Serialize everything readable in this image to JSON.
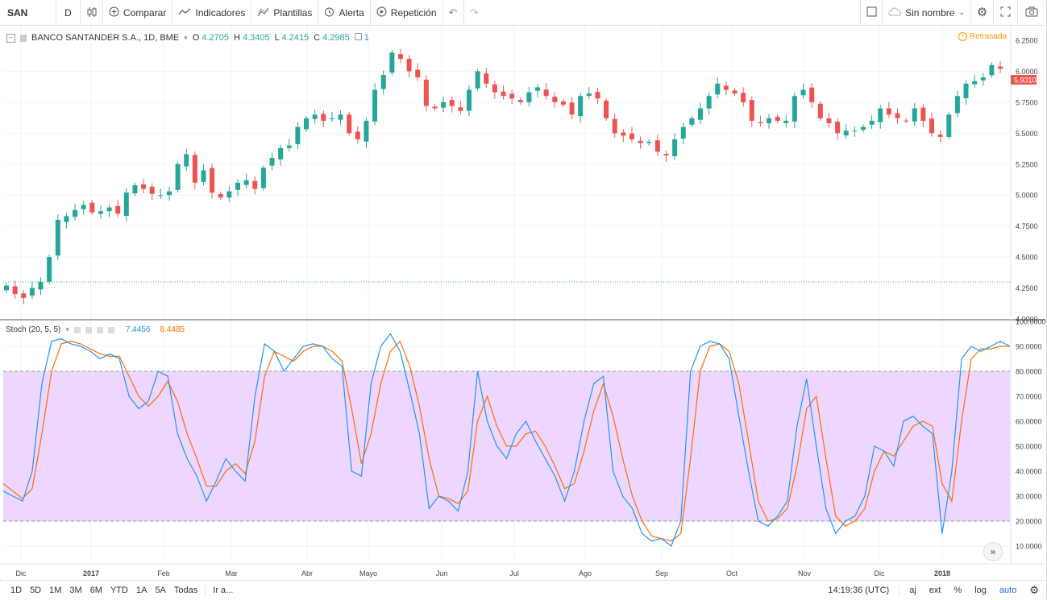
{
  "toolbar": {
    "symbol": "SAN",
    "interval": "D",
    "compare": "Comparar",
    "indicators": "Indicadores",
    "templates": "Plantillas",
    "alert": "Alerta",
    "replay": "Repetición",
    "layout_name": "Sin nombre"
  },
  "legend": {
    "title": "BANCO SANTANDER S.A., 1D, BME",
    "o_label": "O",
    "o_value": "4.2705",
    "h_label": "H",
    "h_value": "4.3405",
    "l_label": "L",
    "l_value": "4.2415",
    "c_label": "C",
    "c_value": "4.2985",
    "badge": "1",
    "status": "Retrasada"
  },
  "stoch_legend": {
    "name": "Stoch (20, 5, 5)",
    "k_value": "7.4456",
    "d_value": "8.4485"
  },
  "price_axis": {
    "ticks": [
      "6.2500",
      "6.0000",
      "5.7500",
      "5.5000",
      "5.2500",
      "5.0000",
      "4.7500",
      "4.5000",
      "4.2500",
      "4.0000"
    ],
    "last_price": "5.9310"
  },
  "stoch_axis": {
    "ticks": [
      "100.0000",
      "90.0000",
      "80.0000",
      "70.0000",
      "60.0000",
      "50.0000",
      "40.0000",
      "30.0000",
      "20.0000",
      "10.0000"
    ]
  },
  "time_axis": {
    "labels": [
      "Dic",
      "2017",
      "Feb",
      "Mar",
      "Abr",
      "Mayo",
      "Jun",
      "Jul",
      "Ago",
      "Sep",
      "Oct",
      "Nov",
      "Dic",
      "2018"
    ]
  },
  "bottombar": {
    "ranges": [
      "1D",
      "5D",
      "1M",
      "3M",
      "6M",
      "YTD",
      "1A",
      "5A",
      "Todas"
    ],
    "goto": "Ir a...",
    "clock": "14:19:36 (UTC)",
    "adj": "aj",
    "ext": "ext",
    "percent": "%",
    "log": "log",
    "auto": "auto"
  },
  "colors": {
    "up": "#26a69a",
    "down": "#ef5350",
    "k_line": "#2196f3",
    "d_line": "#ff6d00",
    "band_fill": "#e8ccff",
    "accent": "#2962ff"
  },
  "chart_data": [
    {
      "type": "candlestick",
      "title": "BANCO SANTANDER S.A., 1D, BME",
      "ylim": [
        4.0,
        6.3
      ],
      "x_labels": [
        "Dic",
        "2017",
        "Feb",
        "Mar",
        "Abr",
        "Mayo",
        "Jun",
        "Jul",
        "Ago",
        "Sep",
        "Oct",
        "Nov",
        "Dic",
        "2018"
      ],
      "close_path": [
        4.27,
        4.2,
        4.17,
        4.25,
        4.3,
        4.5,
        4.8,
        4.83,
        4.88,
        4.92,
        4.86,
        4.87,
        4.9,
        4.85,
        5.02,
        5.08,
        5.05,
        5.01,
        5.0,
        5.03,
        5.25,
        5.33,
        5.1,
        5.2,
        5.02,
        4.98,
        5.03,
        5.1,
        5.12,
        5.05,
        5.22,
        5.3,
        5.38,
        5.4,
        5.55,
        5.62,
        5.65,
        5.6,
        5.62,
        5.65,
        5.5,
        5.45,
        5.6,
        5.85,
        5.97,
        6.15,
        6.1,
        6.0,
        5.95,
        5.72,
        5.7,
        5.75,
        5.72,
        5.68,
        5.85,
        6.0,
        5.9,
        5.83,
        5.8,
        5.78,
        5.75,
        5.83,
        5.87,
        5.8,
        5.75,
        5.73,
        5.65,
        5.8,
        5.82,
        5.78,
        5.62,
        5.5,
        5.48,
        5.45,
        5.42,
        5.43,
        5.35,
        5.32,
        5.45,
        5.55,
        5.62,
        5.7,
        5.8,
        5.9,
        5.85,
        5.82,
        5.75,
        5.6,
        5.58,
        5.62,
        5.6,
        5.6,
        5.8,
        5.85,
        5.75,
        5.62,
        5.58,
        5.5,
        5.52,
        5.52,
        5.55,
        5.6,
        5.7,
        5.65,
        5.62,
        5.6,
        5.7,
        5.6,
        5.5,
        5.47,
        5.65,
        5.8,
        5.9,
        5.92,
        5.95,
        6.05,
        6.02
      ],
      "last_price": 5.931
    },
    {
      "type": "line",
      "title": "Stoch (20, 5, 5)",
      "ylim": [
        0,
        100
      ],
      "bands": [
        20,
        80
      ],
      "series": [
        {
          "name": "%K",
          "values": [
            32,
            30,
            28,
            40,
            75,
            92,
            93,
            91,
            90,
            88,
            85,
            87,
            85,
            70,
            65,
            68,
            80,
            78,
            55,
            45,
            38,
            28,
            36,
            45,
            40,
            36,
            70,
            91,
            88,
            80,
            85,
            90,
            91,
            90,
            85,
            82,
            40,
            38,
            75,
            90,
            95,
            88,
            72,
            55,
            25,
            30,
            28,
            24,
            40,
            80,
            60,
            50,
            45,
            55,
            60,
            52,
            45,
            38,
            28,
            40,
            60,
            75,
            78,
            40,
            30,
            25,
            15,
            12,
            13,
            10,
            20,
            80,
            90,
            92,
            91,
            85,
            62,
            40,
            20,
            18,
            22,
            28,
            58,
            77,
            50,
            25,
            15,
            20,
            22,
            30,
            50,
            48,
            42,
            60,
            62,
            58,
            55,
            15,
            40,
            85,
            90,
            88,
            90,
            92,
            90
          ],
          "last": 7.4456
        },
        {
          "name": "%D",
          "values": [
            35,
            32,
            29,
            33,
            55,
            80,
            91,
            92,
            91,
            89,
            87,
            86,
            86,
            78,
            70,
            66,
            70,
            76,
            68,
            55,
            45,
            34,
            34,
            40,
            43,
            39,
            52,
            78,
            88,
            86,
            84,
            88,
            90,
            90,
            88,
            84,
            65,
            43,
            55,
            75,
            88,
            92,
            82,
            66,
            45,
            30,
            29,
            27,
            32,
            60,
            70,
            58,
            50,
            50,
            55,
            56,
            50,
            42,
            33,
            35,
            48,
            64,
            75,
            62,
            45,
            30,
            20,
            14,
            13,
            12,
            15,
            45,
            80,
            90,
            91,
            88,
            75,
            52,
            28,
            20,
            21,
            25,
            42,
            65,
            70,
            45,
            22,
            18,
            20,
            25,
            40,
            48,
            46,
            52,
            58,
            60,
            58,
            35,
            28,
            60,
            85,
            89,
            89,
            90,
            90
          ],
          "last": 8.4485
        }
      ]
    }
  ]
}
